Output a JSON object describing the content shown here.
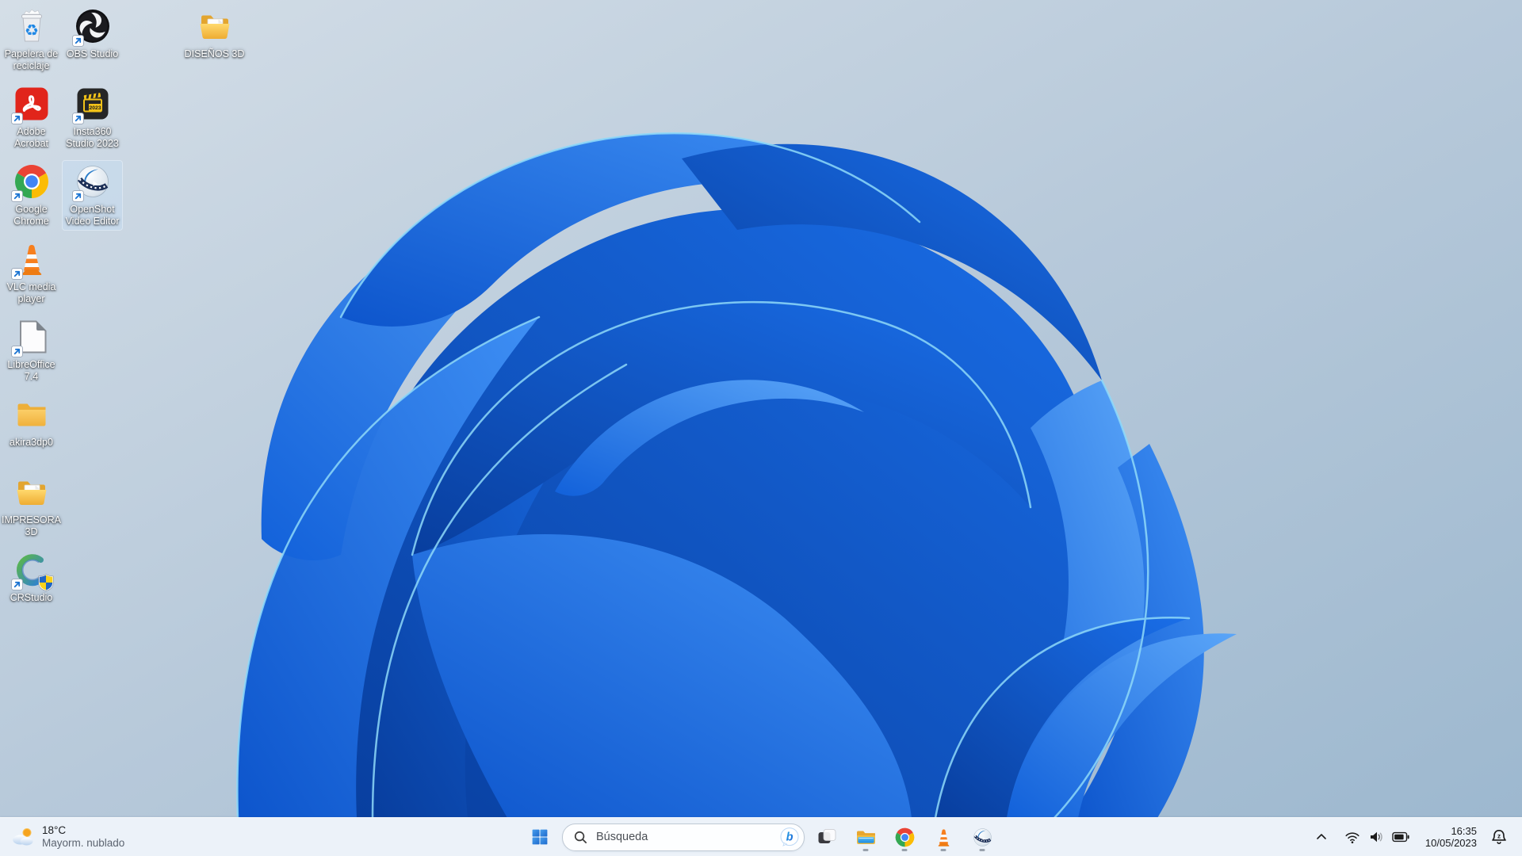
{
  "desktop": {
    "icons": [
      {
        "id": "recycle-bin",
        "label": "Papelera de reciclaje",
        "icon": "recycle-bin-icon",
        "art": "recycle",
        "col": 0,
        "row": 0,
        "shortcut": false,
        "selected": false,
        "shield": false
      },
      {
        "id": "obs-studio",
        "label": "OBS Studio",
        "icon": "obs-studio-icon",
        "art": "obs",
        "col": 1,
        "row": 0,
        "shortcut": true,
        "selected": false,
        "shield": false
      },
      {
        "id": "disenos-3d",
        "label": "DISEÑOS 3D",
        "icon": "folder-open-icon",
        "art": "folderOpen",
        "col": 3,
        "row": 0,
        "shortcut": false,
        "selected": false,
        "shield": false
      },
      {
        "id": "adobe-acrobat",
        "label": "Adobe Acrobat",
        "icon": "acrobat-icon",
        "art": "acrobat",
        "col": 0,
        "row": 1,
        "shortcut": true,
        "selected": false,
        "shield": false
      },
      {
        "id": "insta360-studio",
        "label": "Insta360 Studio 2023",
        "icon": "insta360-icon",
        "art": "insta360",
        "col": 1,
        "row": 1,
        "shortcut": true,
        "selected": false,
        "shield": false
      },
      {
        "id": "google-chrome",
        "label": "Google Chrome",
        "icon": "chrome-icon",
        "art": "chrome",
        "col": 0,
        "row": 2,
        "shortcut": true,
        "selected": false,
        "shield": false
      },
      {
        "id": "openshot",
        "label": "OpenShot Video Editor",
        "icon": "openshot-icon",
        "art": "openshot",
        "col": 1,
        "row": 2,
        "shortcut": true,
        "selected": true,
        "shield": false
      },
      {
        "id": "vlc",
        "label": "VLC media player",
        "icon": "vlc-icon",
        "art": "vlc",
        "col": 0,
        "row": 3,
        "shortcut": true,
        "selected": false,
        "shield": false
      },
      {
        "id": "libreoffice",
        "label": "LibreOffice 7.4",
        "icon": "libreoffice-icon",
        "art": "libre",
        "col": 0,
        "row": 4,
        "shortcut": true,
        "selected": false,
        "shield": false
      },
      {
        "id": "akira3dp0",
        "label": "akira3dp0",
        "icon": "folder-closed-icon",
        "art": "folderClosed",
        "col": 0,
        "row": 5,
        "shortcut": false,
        "selected": false,
        "shield": false
      },
      {
        "id": "impresora-3d",
        "label": "IMPRESORA 3D",
        "icon": "folder-open-icon",
        "art": "folderOpen",
        "col": 0,
        "row": 6,
        "shortcut": false,
        "selected": false,
        "shield": false
      },
      {
        "id": "crstudio",
        "label": "CRStudio",
        "icon": "crstudio-icon",
        "art": "crstudio",
        "col": 0,
        "row": 7,
        "shortcut": true,
        "selected": false,
        "shield": true
      }
    ]
  },
  "taskbar": {
    "weather": {
      "temperature": "18°C",
      "condition": "Mayorm. nublado"
    },
    "search": {
      "placeholder": "Búsqueda"
    },
    "apps": [
      {
        "id": "task-view",
        "icon": "task-view-icon",
        "art": "taskview",
        "running": false
      },
      {
        "id": "file-explorer",
        "icon": "file-explorer-icon",
        "art": "explorer",
        "running": true
      },
      {
        "id": "google-chrome",
        "icon": "chrome-icon",
        "art": "chrome",
        "running": true
      },
      {
        "id": "vlc",
        "icon": "vlc-icon",
        "art": "vlc",
        "running": true
      },
      {
        "id": "openshot",
        "icon": "openshot-icon",
        "art": "openshot",
        "running": true
      }
    ],
    "tray": {
      "time": "16:35",
      "date": "10/05/2023"
    }
  },
  "colors": {
    "accent": "#1f6ac9",
    "taskbar_bg": "#eef4fa",
    "wallpaper_deep": "#0a47b5",
    "wallpaper_bright": "#3c8df2",
    "selection_highlight": "#cfe2f5"
  }
}
